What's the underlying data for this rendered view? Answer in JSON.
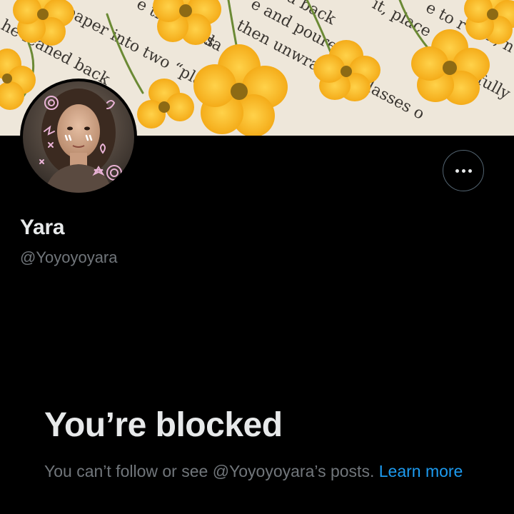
{
  "profile": {
    "display_name": "Yara",
    "handle": "@Yoyoyoyara"
  },
  "more_button": {
    "icon": "more-horizontal-icon"
  },
  "blocked": {
    "title": "You’re blocked",
    "message_prefix": "You can’t follow or see ",
    "message_handle": "@Yoyoyoyara",
    "message_suffix": "’s posts.",
    "learn_more_label": "Learn more"
  },
  "banner": {
    "text_fragments": [
      "he leaned back",
      "paper into two “plate",
      "e time of da",
      "es",
      "then unwrapped a",
      "e and poure",
      "d back",
      "it, place",
      "e to r",
      "x, n",
      "efully",
      "glasses o"
    ]
  },
  "colors": {
    "background": "#000000",
    "primary_text": "#e7e9ea",
    "secondary_text": "#71767b",
    "link": "#1d9bf0",
    "border": "#536471",
    "flower_yellow": "#f7b51c"
  }
}
